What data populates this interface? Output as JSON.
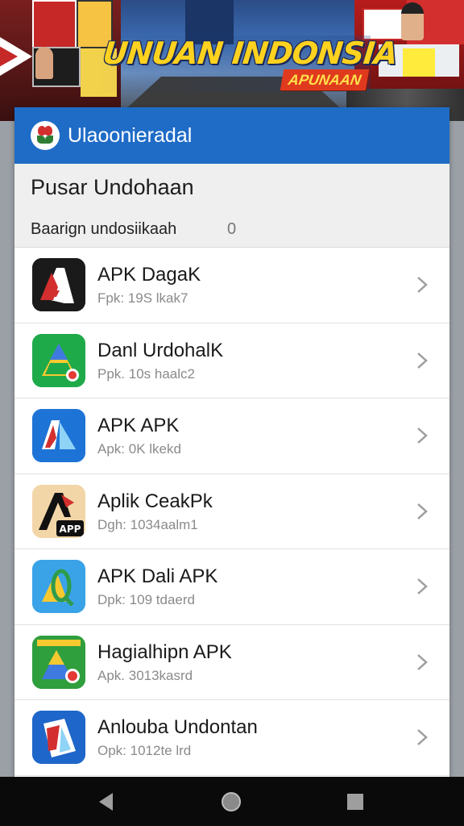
{
  "banner": {
    "title": "UNUAN INDONSIA",
    "subtitle": "APUNAAN"
  },
  "app": {
    "title": "Ulaoonieradal"
  },
  "section": {
    "title": "Pusar Undohaan",
    "row_label": "Baarign undosiikaah",
    "row_count": "0"
  },
  "items": [
    {
      "name": "APK DagaK",
      "sub": "Fpk: 19S lkak7",
      "icon": "apk-red-a-icon"
    },
    {
      "name": "Danl UrdohalK",
      "sub": "Ppk. 10s haalc2",
      "icon": "green-triangle-icon"
    },
    {
      "name": "APK APK",
      "sub": "Apk: 0K lkekd",
      "icon": "blue-j-icon"
    },
    {
      "name": "Aplik CeakPk",
      "sub": "Dgh: 1034aalm1",
      "icon": "apk-black-a-icon"
    },
    {
      "name": "APK Dali APK",
      "sub": "Dpk: 109 tdaerd",
      "icon": "blue-q-icon"
    },
    {
      "name": "Hagialhipn APK",
      "sub": "Apk. 3013kasrd",
      "icon": "green-apk-icon"
    },
    {
      "name": "Anlouba Undontan",
      "sub": "Opk: 1012te lrd",
      "icon": "blue-box-icon"
    }
  ],
  "colors": {
    "appbar": "#1f6cc7",
    "banner_text": "#ffd21f",
    "nav": "#0a0a0a"
  }
}
